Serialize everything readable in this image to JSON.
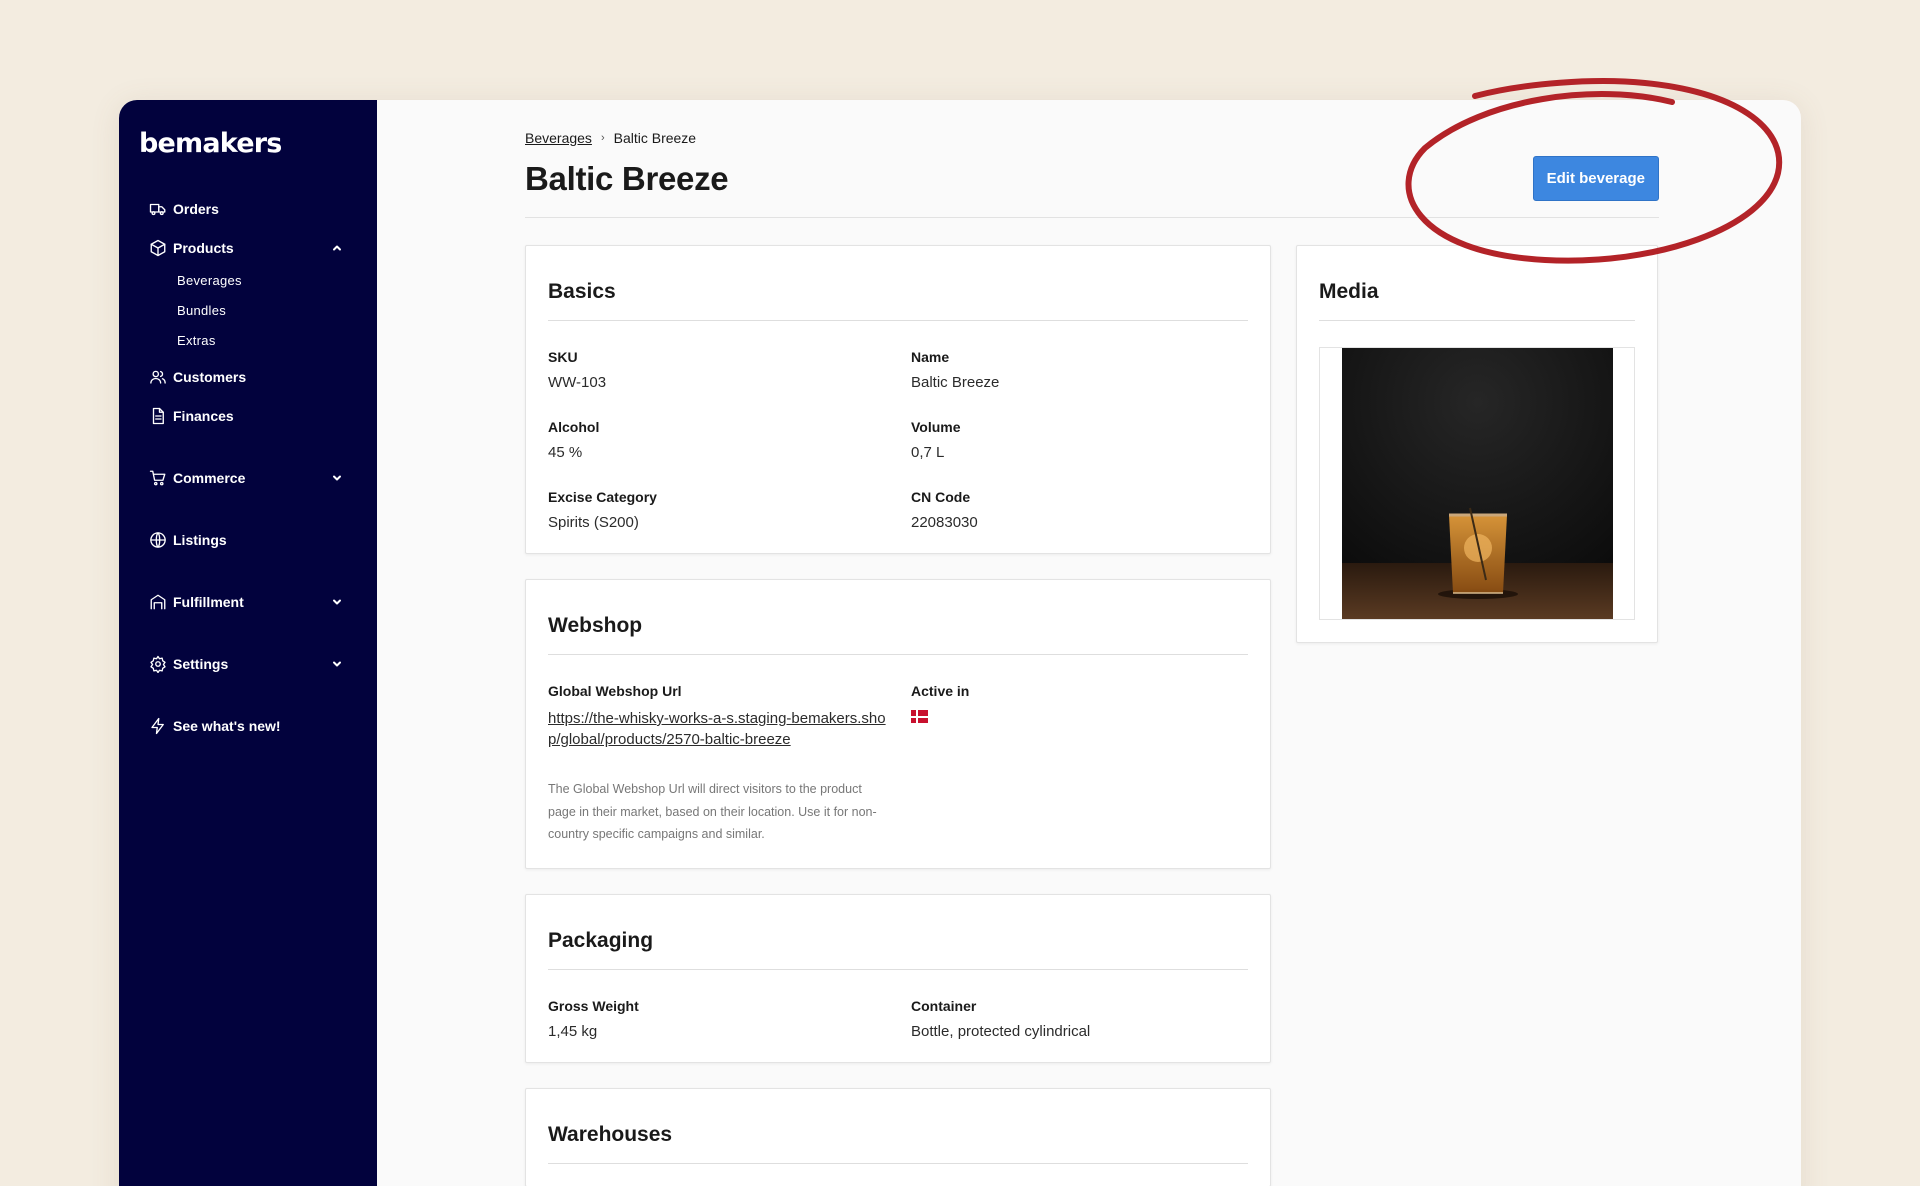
{
  "brand": "bemakers",
  "sidebar": {
    "items": [
      {
        "label": "Orders",
        "icon": "truck-icon"
      },
      {
        "label": "Products",
        "icon": "cube-icon",
        "expanded": true,
        "children": [
          "Beverages",
          "Bundles",
          "Extras"
        ]
      },
      {
        "label": "Customers",
        "icon": "users-icon"
      },
      {
        "label": "Finances",
        "icon": "document-icon"
      },
      {
        "label": "Commerce",
        "icon": "cart-icon"
      },
      {
        "label": "Listings",
        "icon": "globe-icon"
      },
      {
        "label": "Fulfillment",
        "icon": "warehouse-icon"
      },
      {
        "label": "Settings",
        "icon": "gear-icon"
      },
      {
        "label": "See what's new!",
        "icon": "bolt-icon"
      }
    ]
  },
  "breadcrumb": {
    "parent": "Beverages",
    "current": "Baltic Breeze"
  },
  "header": {
    "title": "Baltic Breeze",
    "edit_button": "Edit beverage"
  },
  "basics": {
    "title": "Basics",
    "fields": [
      {
        "label": "SKU",
        "value": "WW-103"
      },
      {
        "label": "Name",
        "value": "Baltic Breeze"
      },
      {
        "label": "Alcohol",
        "value": "45 %"
      },
      {
        "label": "Volume",
        "value": "0,7 L"
      },
      {
        "label": "Excise Category",
        "value": "Spirits (S200)"
      },
      {
        "label": "CN Code",
        "value": "22083030"
      }
    ]
  },
  "webshop": {
    "title": "Webshop",
    "url_label": "Global Webshop Url",
    "url_value": "https://the-whisky-works-a-s.staging-bemakers.shop/global/products/2570-baltic-breeze",
    "active_label": "Active in",
    "active_flag": "denmark-flag-icon",
    "help": "The Global Webshop Url will direct visitors to the product page in their market, based on their location. Use it for non-country specific campaigns and similar."
  },
  "packaging": {
    "title": "Packaging",
    "fields": [
      {
        "label": "Gross Weight",
        "value": "1,45 kg"
      },
      {
        "label": "Container",
        "value": "Bottle, protected cylindrical"
      }
    ]
  },
  "warehouses": {
    "title": "Warehouses"
  },
  "media": {
    "title": "Media"
  },
  "colors": {
    "sidebar": "#02023d",
    "accent": "#3d87e0",
    "annotation": "#b32328",
    "background": "#f3ece0"
  }
}
